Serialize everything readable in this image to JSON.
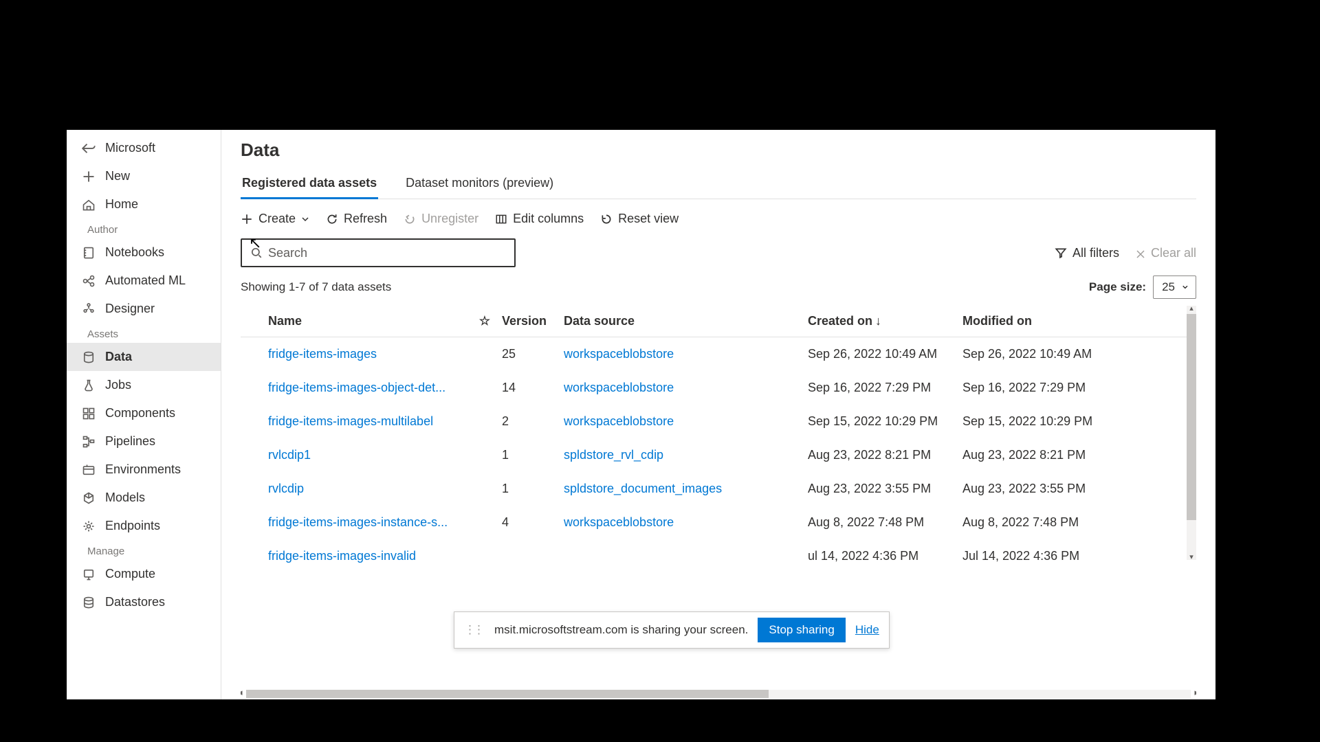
{
  "sidebar": {
    "workspace": "Microsoft",
    "new": "New",
    "home": "Home",
    "sections": {
      "author": "Author",
      "assets": "Assets",
      "manage": "Manage"
    },
    "items": {
      "notebooks": "Notebooks",
      "automated_ml": "Automated ML",
      "designer": "Designer",
      "data": "Data",
      "jobs": "Jobs",
      "components": "Components",
      "pipelines": "Pipelines",
      "environments": "Environments",
      "models": "Models",
      "endpoints": "Endpoints",
      "compute": "Compute",
      "datastores": "Datastores"
    }
  },
  "page": {
    "title": "Data",
    "tabs": {
      "registered": "Registered data assets",
      "monitors": "Dataset monitors (preview)"
    },
    "toolbar": {
      "create": "Create",
      "refresh": "Refresh",
      "unregister": "Unregister",
      "edit_columns": "Edit columns",
      "reset_view": "Reset view"
    },
    "search_placeholder": "Search",
    "filters": {
      "all": "All filters",
      "clear": "Clear all"
    },
    "status": "Showing 1-7 of 7 data assets",
    "page_size_label": "Page size:",
    "page_size_value": "25",
    "columns": {
      "name": "Name",
      "version": "Version",
      "data_source": "Data source",
      "created_on": "Created on",
      "modified_on": "Modified on"
    },
    "rows": [
      {
        "name": "fridge-items-images",
        "version": "25",
        "source": "workspaceblobstore",
        "created": "Sep 26, 2022 10:49 AM",
        "modified": "Sep 26, 2022 10:49 AM"
      },
      {
        "name": "fridge-items-images-object-det...",
        "version": "14",
        "source": "workspaceblobstore",
        "created": "Sep 16, 2022 7:29 PM",
        "modified": "Sep 16, 2022 7:29 PM"
      },
      {
        "name": "fridge-items-images-multilabel",
        "version": "2",
        "source": "workspaceblobstore",
        "created": "Sep 15, 2022 10:29 PM",
        "modified": "Sep 15, 2022 10:29 PM"
      },
      {
        "name": "rvlcdip1",
        "version": "1",
        "source": "spldstore_rvl_cdip",
        "created": "Aug 23, 2022 8:21 PM",
        "modified": "Aug 23, 2022 8:21 PM"
      },
      {
        "name": "rvlcdip",
        "version": "1",
        "source": "spldstore_document_images",
        "created": "Aug 23, 2022 3:55 PM",
        "modified": "Aug 23, 2022 3:55 PM"
      },
      {
        "name": "fridge-items-images-instance-s...",
        "version": "4",
        "source": "workspaceblobstore",
        "created": "Aug 8, 2022 7:48 PM",
        "modified": "Aug 8, 2022 7:48 PM"
      },
      {
        "name": "fridge-items-images-invalid",
        "version": "",
        "source": "",
        "created": "ul 14, 2022 4:36 PM",
        "modified": "Jul 14, 2022 4:36 PM"
      }
    ]
  },
  "share_bar": {
    "message": "msit.microsoftstream.com is sharing your screen.",
    "stop": "Stop sharing",
    "hide": "Hide"
  }
}
